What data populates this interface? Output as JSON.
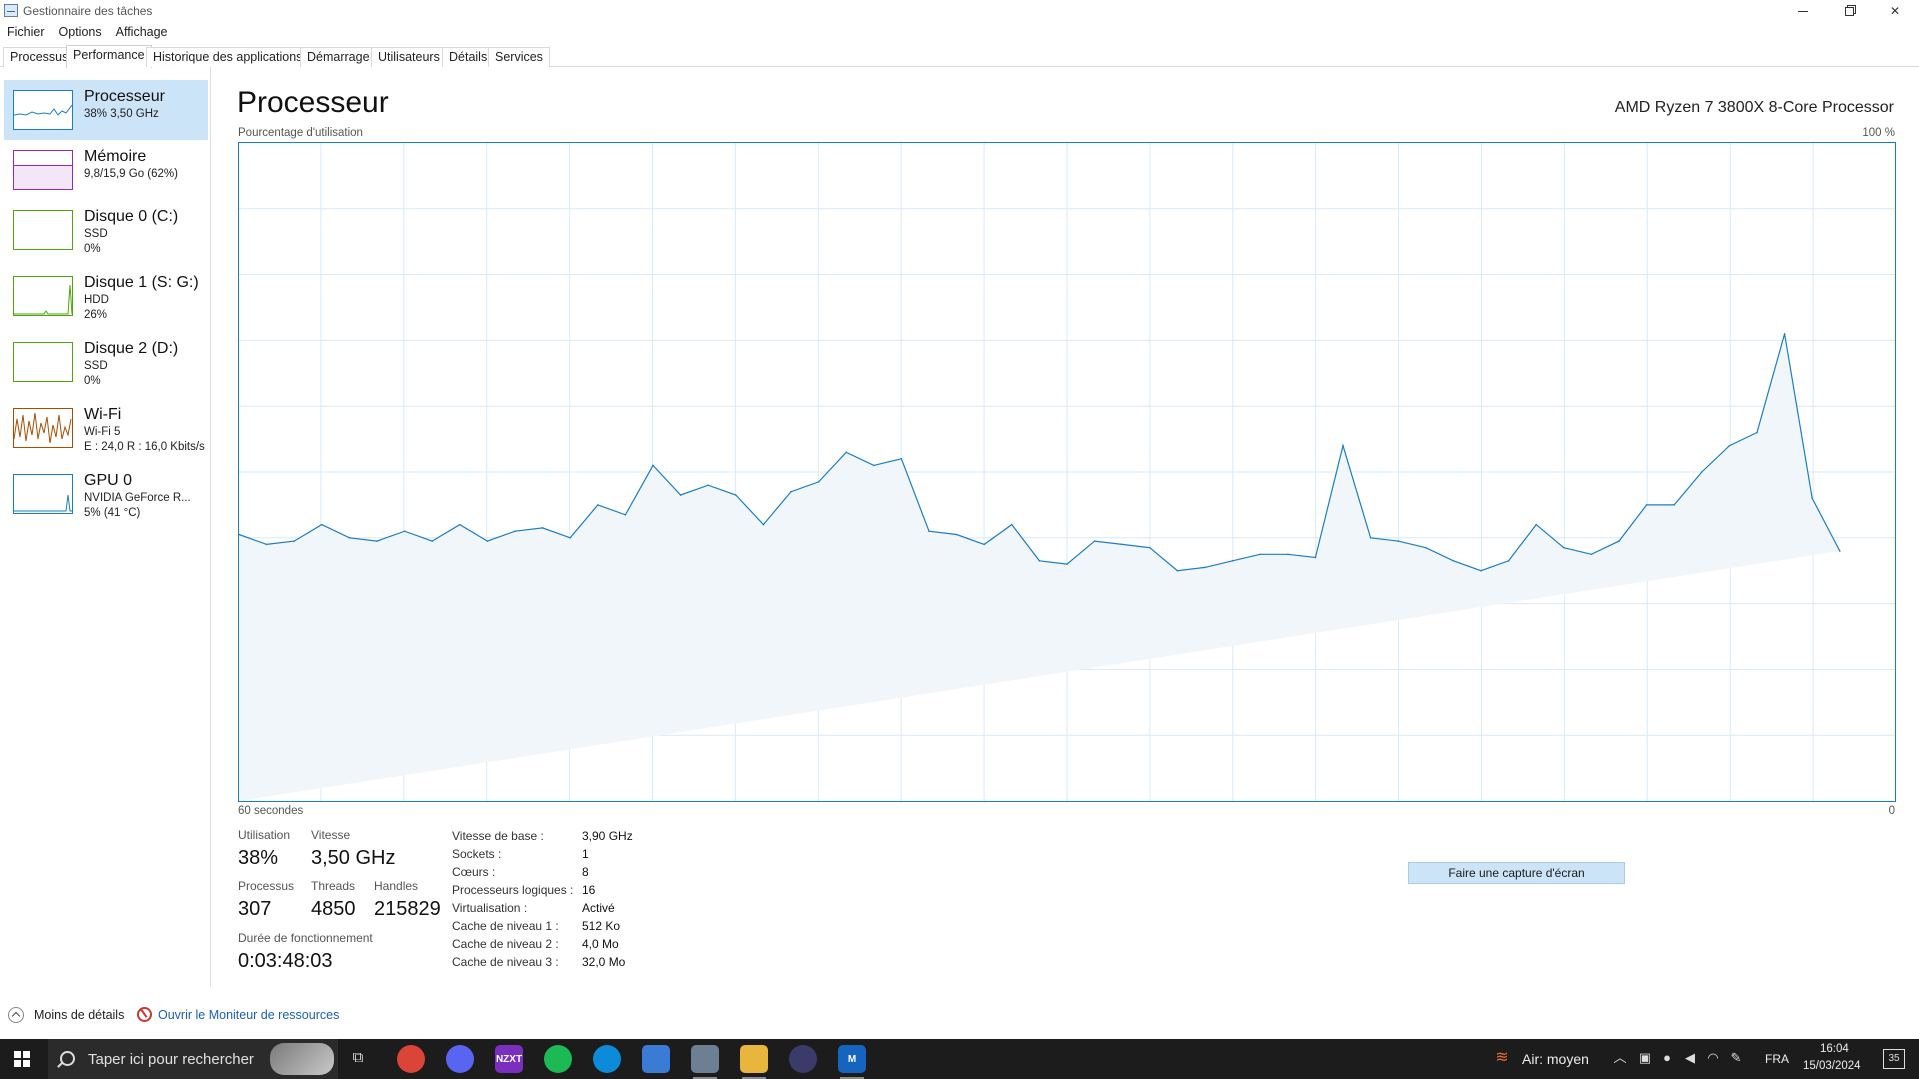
{
  "window": {
    "title": "Gestionnaire des tâches"
  },
  "menu": [
    "Fichier",
    "Options",
    "Affichage"
  ],
  "tabs": [
    "Processus",
    "Performance",
    "Historique des applications",
    "Démarrage",
    "Utilisateurs",
    "Détails",
    "Services"
  ],
  "active_tab": "Performance",
  "sidebar": {
    "items": [
      {
        "name": "Processeur",
        "line1": "38% 3,50 GHz",
        "line2": "",
        "color": "#1a7ec4"
      },
      {
        "name": "Mémoire",
        "line1": "9,8/15,9 Go (62%)",
        "line2": "",
        "color": "#9528b4"
      },
      {
        "name": "Disque 0 (C:)",
        "line1": "SSD",
        "line2": "0%",
        "color": "#4da60c"
      },
      {
        "name": "Disque 1 (S: G:)",
        "line1": "HDD",
        "line2": "26%",
        "color": "#4da60c"
      },
      {
        "name": "Disque 2 (D:)",
        "line1": "SSD",
        "line2": "0%",
        "color": "#4da60c"
      },
      {
        "name": "Wi-Fi",
        "line1": "Wi-Fi 5",
        "line2": "E : 24,0 R : 16,0 Kbits/s",
        "color": "#a74f01"
      },
      {
        "name": "GPU 0",
        "line1": "NVIDIA GeForce R...",
        "line2": "5% (41 °C)",
        "color": "#1a7ec4"
      }
    ]
  },
  "main": {
    "title": "Processeur",
    "cpu_name": "AMD Ryzen 7 3800X 8-Core Processor",
    "chart_ylabel": "Pourcentage d'utilisation",
    "chart_ymax_label": "100 %",
    "chart_xleft_label": "60 secondes",
    "chart_xright_label": "0"
  },
  "chart_data": {
    "type": "area",
    "title": "",
    "xlabel": "",
    "ylabel": "Pourcentage d'utilisation",
    "xlim": [
      60,
      0
    ],
    "ylim": [
      0,
      100
    ],
    "grid": true,
    "color": "#1a7ec4",
    "x": [
      60,
      59,
      58,
      57,
      56,
      55,
      54,
      53,
      52,
      51,
      50,
      49,
      48,
      47,
      46,
      45,
      44,
      43,
      42,
      41,
      40,
      39,
      38,
      37,
      36,
      35,
      34,
      33,
      32,
      31,
      30,
      29,
      28,
      27,
      26,
      25,
      24,
      23,
      22,
      21,
      20,
      19,
      18,
      17,
      16,
      15,
      14,
      13,
      12,
      11,
      10,
      9,
      8,
      7,
      6,
      5,
      4,
      3,
      2,
      1,
      0
    ],
    "series": [
      {
        "values": [
          40.5,
          39,
          39.5,
          42,
          40,
          39.5,
          41,
          39.5,
          42,
          39.5,
          41,
          41.5,
          40,
          45,
          43.5,
          51,
          46.5,
          48,
          46.5,
          42,
          47,
          48.5,
          53,
          51,
          52,
          41,
          40.5,
          39,
          42,
          36.5,
          36,
          39.5,
          39,
          38.5,
          35,
          35.5,
          36.5,
          37.5,
          37.5,
          37,
          54,
          40,
          39.5,
          38.5,
          36.5,
          35,
          36.5,
          42,
          38.5,
          37.5,
          39.5,
          45,
          45,
          50,
          54,
          56,
          71,
          46,
          38
        ]
      }
    ]
  },
  "stats": {
    "utilisation_label": "Utilisation",
    "utilisation": "38%",
    "vitesse_label": "Vitesse",
    "vitesse": "3,50 GHz",
    "processus_label": "Processus",
    "processus": "307",
    "threads_label": "Threads",
    "threads": "4850",
    "handles_label": "Handles",
    "handles": "215829",
    "uptime_label": "Durée de fonctionnement",
    "uptime": "0:03:48:03"
  },
  "info": [
    {
      "label": "Vitesse de base :",
      "value": "3,90 GHz"
    },
    {
      "label": "Sockets :",
      "value": "1"
    },
    {
      "label": "Cœurs :",
      "value": "8"
    },
    {
      "label": "Processeurs logiques :",
      "value": "16"
    },
    {
      "label": "Virtualisation :",
      "value": "Activé"
    },
    {
      "label": "Cache de niveau 1 :",
      "value": "512 Ko"
    },
    {
      "label": "Cache de niveau 2 :",
      "value": "4,0 Mo"
    },
    {
      "label": "Cache de niveau 3 :",
      "value": "32,0 Mo"
    }
  ],
  "capture_button": "Faire une capture d'écran",
  "footer": {
    "less_details": "Moins de détails",
    "monitor_link": "Ouvrir le Moniteur de ressources"
  },
  "taskbar": {
    "search_placeholder": "Taper ici pour rechercher",
    "apps": [
      {
        "icon": "chrome-icon",
        "color": "#db4437"
      },
      {
        "icon": "discord-icon",
        "color": "#5865f2"
      },
      {
        "icon": "nzxt-icon",
        "color": "#7b2fbe",
        "label": "NZXT"
      },
      {
        "icon": "spotify-icon",
        "color": "#1db954"
      },
      {
        "icon": "edge-icon",
        "color": "#0c8bd8"
      },
      {
        "icon": "app-icon",
        "color": "#3a7bd5"
      },
      {
        "icon": "task-manager-icon",
        "color": "#6d7f93"
      },
      {
        "icon": "file-explorer-icon",
        "color": "#e8b63c"
      },
      {
        "icon": "obs-icon",
        "color": "#3b3b6b"
      },
      {
        "icon": "malwarebytes-icon",
        "color": "#1565c0",
        "label": "M"
      }
    ],
    "weather": "Air: moyen",
    "language": "FRA",
    "time": "16:04",
    "date": "15/03/2024",
    "notifications": "35"
  }
}
